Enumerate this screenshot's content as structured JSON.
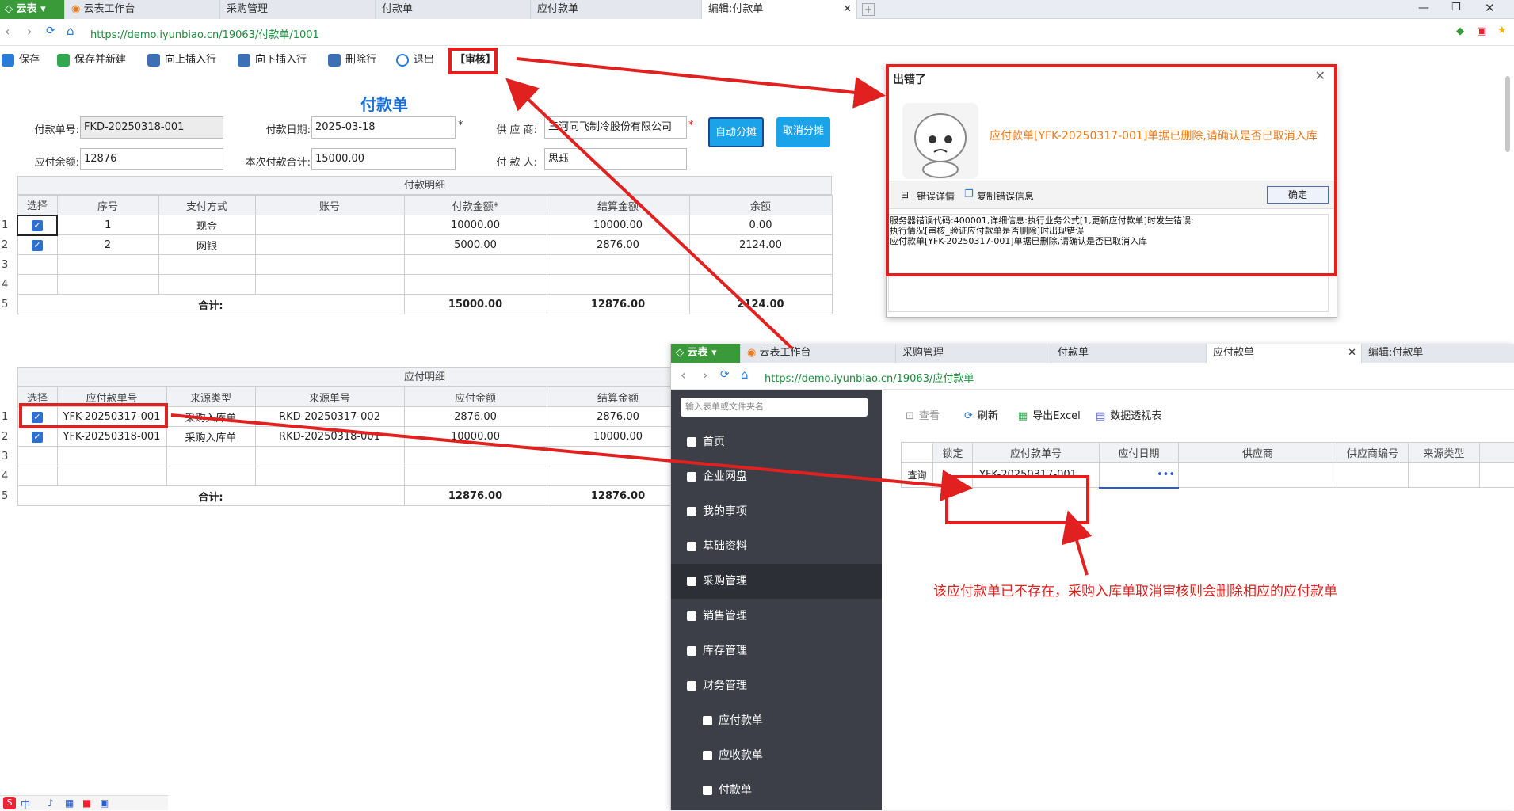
{
  "browser": {
    "brand": "云表",
    "tabs": [
      "云表工作台",
      "采购管理",
      "付款单",
      "应付款单",
      "编辑:付款单"
    ],
    "url": "https://demo.iyunbiao.cn/19063/付款单/1001"
  },
  "toolbar": {
    "save": "保存",
    "save_new": "保存并新建",
    "insert_up": "向上插入行",
    "insert_down": "向下插入行",
    "delete_row": "删除行",
    "exit": "退出",
    "review": "【审核】"
  },
  "form": {
    "title": "付款单",
    "no_label": "付款单号:",
    "no_value": "FKD-20250318-001",
    "date_label": "付款日期:",
    "date_value": "2025-03-18",
    "date_star": "*",
    "supplier_label": "供 应 商:",
    "supplier_value": "三河同飞制冷股份有限公司",
    "supplier_star": "*",
    "auto_alloc": "自动分摊",
    "cancel_alloc": "取消分摊",
    "balance_label": "应付余额:",
    "balance_value": "12876",
    "total_label": "本次付款合计:",
    "total_value": "15000.00",
    "payer_label": "付 款 人:",
    "payer_value": "思珏"
  },
  "pay_detail": {
    "caption": "付款明细",
    "headers": [
      "选择",
      "序号",
      "支付方式",
      "账号",
      "付款金额*",
      "结算金额",
      "余额"
    ],
    "rows": [
      {
        "n": "1",
        "checked": true,
        "seq": "1",
        "method": "现金",
        "account": "",
        "amount": "10000.00",
        "settle": "10000.00",
        "balance": "0.00"
      },
      {
        "n": "2",
        "checked": true,
        "seq": "2",
        "method": "网银",
        "account": "",
        "amount": "5000.00",
        "settle": "2876.00",
        "balance": "2124.00"
      },
      {
        "n": "3"
      },
      {
        "n": "4"
      }
    ],
    "total_row_n": "5",
    "total_label": "合计:",
    "total_amount": "15000.00",
    "total_settle": "12876.00",
    "total_balance": "2124.00"
  },
  "payable_detail": {
    "caption": "应付明细",
    "headers": [
      "选择",
      "应付款单号",
      "来源类型",
      "来源单号",
      "应付金额",
      "结算金额"
    ],
    "rows": [
      {
        "n": "1",
        "checked": true,
        "no": "YFK-20250317-001",
        "src_type": "采购入库单",
        "src_no": "RKD-20250317-002",
        "amount": "2876.00",
        "settle": "2876.00"
      },
      {
        "n": "2",
        "checked": true,
        "no": "YFK-20250318-001",
        "src_type": "采购入库单",
        "src_no": "RKD-20250318-001",
        "amount": "10000.00",
        "settle": "10000.00"
      },
      {
        "n": "3"
      },
      {
        "n": "4"
      }
    ],
    "total_row_n": "5",
    "total_label": "合计:",
    "total_amount": "12876.00",
    "total_settle": "12876.00"
  },
  "dialog": {
    "title": "出错了",
    "message": "应付款单[YFK-20250317-001]单据已删除,请确认是否已取消入库",
    "details_toggle": "错误详情",
    "copy": "复制错误信息",
    "ok": "确定",
    "detail_lines": [
      "服务器错误代码:400001,详细信息:执行业务公式[1,更新应付款单]时发生错误:",
      "执行情况[审核_验证应付款单是否删除]时出现错误",
      "应付款单[YFK-20250317-001]单据已删除,请确认是否已取消入库"
    ]
  },
  "window2": {
    "brand": "云表",
    "tabs": [
      "云表工作台",
      "采购管理",
      "付款单",
      "应付款单",
      "编辑:付款单"
    ],
    "url": "https://demo.iyunbiao.cn/19063/应付款单",
    "search_placeholder": "输入表单或文件夹名",
    "menu": [
      "首页",
      "企业网盘",
      "我的事项",
      "基础资料",
      "采购管理",
      "销售管理",
      "库存管理",
      "财务管理"
    ],
    "submenu": [
      "应付款单",
      "应收款单",
      "付款单"
    ],
    "actions": {
      "view": "查看",
      "refresh": "刷新",
      "export": "导出Excel",
      "pivot": "数据透视表"
    },
    "grid_headers": [
      "锁定",
      "应付款单号",
      "应付日期",
      "供应商",
      "供应商编号",
      "来源类型"
    ],
    "query_label": "查询",
    "query_value": "YFK-20250317-001",
    "query_more": "•••"
  },
  "annotation": {
    "text": "该应付款单已不存在，采购入库单取消审核则会删除相应的应付款单"
  },
  "taskbar": {
    "ime": "中"
  },
  "colors": {
    "accent": "#1aa3e8",
    "annotation": "#e0211f",
    "title_blue": "#1a6fd6",
    "error_orange": "#f07a18"
  }
}
